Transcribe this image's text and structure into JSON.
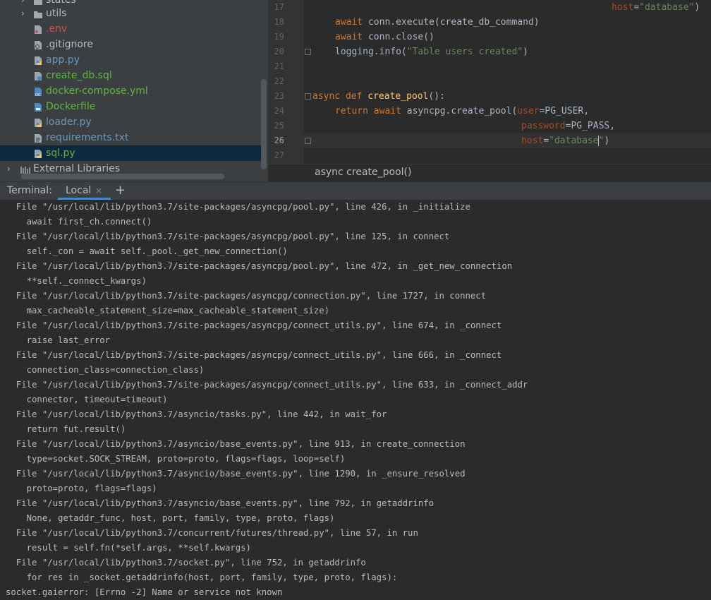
{
  "project_tree": {
    "items": [
      {
        "label": "states",
        "icon": "folder-icon",
        "color": "#bbbbbb"
      },
      {
        "label": "utils",
        "icon": "folder-icon",
        "color": "#bbbbbb"
      },
      {
        "label": ".env",
        "icon": "file-env-icon",
        "color": "#c75450"
      },
      {
        "label": ".gitignore",
        "icon": "file-gitignore-icon",
        "color": "#bbbbbb"
      },
      {
        "label": "app.py",
        "icon": "python-file-icon",
        "color": "#6897bb"
      },
      {
        "label": "create_db.sql",
        "icon": "sql-file-icon",
        "color": "#62b543"
      },
      {
        "label": "docker-compose.yml",
        "icon": "docker-compose-file-icon",
        "color": "#62b543"
      },
      {
        "label": "Dockerfile",
        "icon": "dockerfile-icon",
        "color": "#62b543"
      },
      {
        "label": "loader.py",
        "icon": "python-file-icon",
        "color": "#6897bb"
      },
      {
        "label": "requirements.txt",
        "icon": "text-file-icon",
        "color": "#6897bb"
      },
      {
        "label": "sql.py",
        "icon": "python-file-icon",
        "color": "#62b543"
      },
      {
        "label": "External Libraries",
        "icon": "library-icon",
        "color": "#bbbbbb"
      }
    ]
  },
  "editor": {
    "line_numbers": [
      "17",
      "18",
      "19",
      "20",
      "21",
      "22",
      "23",
      "24",
      "25",
      "26",
      "27"
    ],
    "current_line": "26",
    "code": {
      "l17_kw": "host",
      "l17_eq": "=",
      "l17_str": "\"database\"",
      "l17_close": ")",
      "l18_await": "await",
      "l18_rest": " conn.execute(create_db_command)",
      "l19_await": "await",
      "l19_rest": " conn.close()",
      "l20_rest": "logging.info(",
      "l20_str": "\"Table users created\"",
      "l20_close": ")",
      "l23_async": "async def",
      "l23_fn": "create_pool",
      "l23_rest": "():",
      "l24_return": "return await",
      "l24_rest": " asyncpg.create_pool(",
      "l24_param": "user",
      "l24_val": "=PG_USER,",
      "l25_param": "password",
      "l25_val": "=PG_PASS,",
      "l26_param": "host",
      "l26_eq": "=",
      "l26_str_a": "\"database",
      "l26_str_b": "\"",
      "l26_close": ")"
    },
    "breadcrumb": "async create_pool()"
  },
  "terminal": {
    "title": "Terminal:",
    "tab_label": "Local",
    "close_glyph": "×",
    "add_glyph": "+",
    "lines": [
      "  File \"/usr/local/lib/python3.7/site-packages/asyncpg/pool.py\", line 426, in _initialize",
      "    await first_ch.connect()",
      "  File \"/usr/local/lib/python3.7/site-packages/asyncpg/pool.py\", line 125, in connect",
      "    self._con = await self._pool._get_new_connection()",
      "  File \"/usr/local/lib/python3.7/site-packages/asyncpg/pool.py\", line 472, in _get_new_connection",
      "    **self._connect_kwargs)",
      "  File \"/usr/local/lib/python3.7/site-packages/asyncpg/connection.py\", line 1727, in connect",
      "    max_cacheable_statement_size=max_cacheable_statement_size)",
      "  File \"/usr/local/lib/python3.7/site-packages/asyncpg/connect_utils.py\", line 674, in _connect",
      "    raise last_error",
      "  File \"/usr/local/lib/python3.7/site-packages/asyncpg/connect_utils.py\", line 666, in _connect",
      "    connection_class=connection_class)",
      "  File \"/usr/local/lib/python3.7/site-packages/asyncpg/connect_utils.py\", line 633, in _connect_addr",
      "    connector, timeout=timeout)",
      "  File \"/usr/local/lib/python3.7/asyncio/tasks.py\", line 442, in wait_for",
      "    return fut.result()",
      "  File \"/usr/local/lib/python3.7/asyncio/base_events.py\", line 913, in create_connection",
      "    type=socket.SOCK_STREAM, proto=proto, flags=flags, loop=self)",
      "  File \"/usr/local/lib/python3.7/asyncio/base_events.py\", line 1290, in _ensure_resolved",
      "    proto=proto, flags=flags)",
      "  File \"/usr/local/lib/python3.7/asyncio/base_events.py\", line 792, in getaddrinfo",
      "    None, getaddr_func, host, port, family, type, proto, flags)",
      "  File \"/usr/local/lib/python3.7/concurrent/futures/thread.py\", line 57, in run",
      "    result = self.fn(*self.args, **self.kwargs)",
      "  File \"/usr/local/lib/python3.7/socket.py\", line 752, in getaddrinfo",
      "    for res in _socket.getaddrinfo(host, port, family, type, proto, flags):",
      "socket.gaierror: [Errno -2] Name or service not known"
    ]
  }
}
